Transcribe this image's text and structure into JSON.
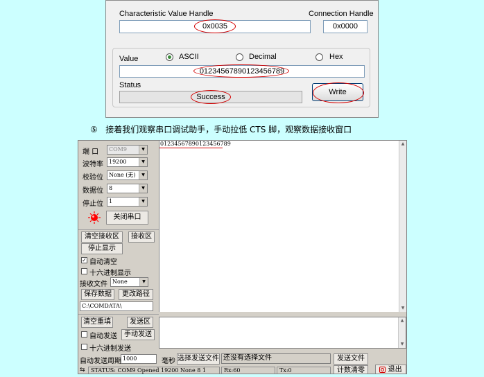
{
  "ble_panel": {
    "char_handle_label": "Characteristic Value Handle",
    "char_handle_value": "0x0035",
    "conn_handle_label": "Connection Handle",
    "conn_handle_value": "0x0000",
    "value_label": "Value",
    "radio_ascii": "ASCII",
    "radio_decimal": "Decimal",
    "radio_hex": "Hex",
    "selected_format": "ASCII",
    "value_field": "01234567890123456789",
    "status_label": "Status",
    "status_value": "Success",
    "write_button": "Write"
  },
  "step_caption": {
    "number": "⑤",
    "text": "接着我们观察串口调试助手，手动拉低 CTS 脚，观察数据接收窗口"
  },
  "serial_assistant": {
    "port_label": "端  口",
    "port_value": "COM9",
    "baud_label": "波特率",
    "baud_value": "19200",
    "parity_label": "校验位",
    "parity_value": "None (无)",
    "databits_label": "数据位",
    "databits_value": "8",
    "stopbits_label": "停止位",
    "stopbits_value": "1",
    "close_port_button": "关闭串口",
    "clear_rx_button": "清空接收区",
    "rx_area_label": "接收区",
    "stop_display_button": "停止显示",
    "auto_clear_label": "自动清空",
    "auto_clear_checked": true,
    "hex_display_label": "十六进制显示",
    "hex_display_checked": false,
    "rx_file_label": "接收文件",
    "rx_file_value": "None",
    "save_data_button": "保存数据",
    "change_path_button": "更改路径",
    "path_value": "C:\\COMDATA\\",
    "received_text": "01234567890123456789",
    "clear_resend_button": "清空重填",
    "tx_area_label": "发送区",
    "auto_send_label": "自动发送",
    "auto_send_checked": false,
    "manual_send_button": "手动发送",
    "hex_send_label": "十六进制发送",
    "hex_send_checked": false,
    "auto_period_label": "自动发送周期",
    "auto_period_value": "1000",
    "ms_label": "毫秒",
    "choose_file_button": "选择发送文件",
    "no_file_text": "还没有选择文件",
    "send_file_button": "发送文件",
    "count_clear_button": "计数清零",
    "exit_button": "退出",
    "status_text": "STATUS: COM9 Opened 19200 None  8  1",
    "rx_count": "Rx:60",
    "tx_count": "Tx:0"
  },
  "colors": {
    "background": "#ccffff",
    "annotation_red": "#d40000",
    "indicator_red": "#ff0000"
  }
}
